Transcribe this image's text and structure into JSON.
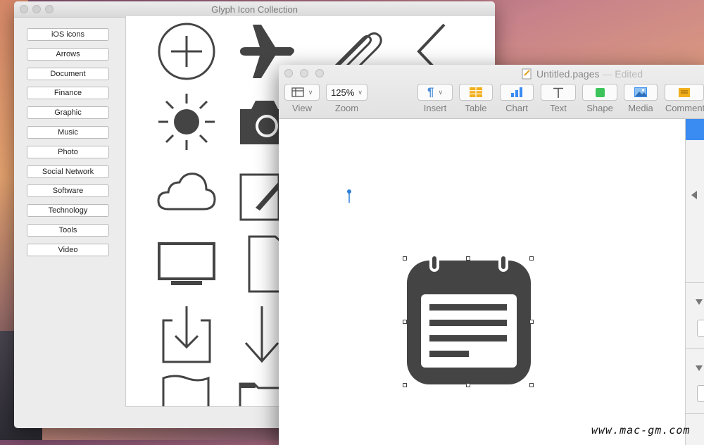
{
  "glyph_window": {
    "title": "Glyph Icon Collection",
    "categories": [
      "iOS icons",
      "Arrows",
      "Document",
      "Finance",
      "Graphic",
      "Music",
      "Photo",
      "Social Network",
      "Software",
      "Technology",
      "Tools",
      "Video"
    ],
    "icons": [
      "plus-circle-icon",
      "airplane-icon",
      "paperclip-icon",
      "chevron-left-icon",
      "sun-icon",
      "camera-icon",
      "cloud-icon",
      "edit-icon",
      "monitor-icon",
      "document-icon",
      "download-icon",
      "arrow-down-icon",
      "flag-icon",
      "folder-icon"
    ]
  },
  "pages_window": {
    "title": "Untitled.pages",
    "separator": "—",
    "status": "Edited",
    "zoom": "125%",
    "toolbar": {
      "view": "View",
      "zoom": "Zoom",
      "insert": "Insert",
      "table": "Table",
      "chart": "Chart",
      "text": "Text",
      "shape": "Shape",
      "media": "Media",
      "comment": "Comment"
    },
    "inserted_image": "notepad-icon"
  },
  "watermark": "www.mac-gm.com",
  "colors": {
    "icon_gray": "#444444",
    "accent_blue": "#3a8cf2",
    "table_orange": "#f2b01e",
    "shape_green": "#3cc45a"
  }
}
